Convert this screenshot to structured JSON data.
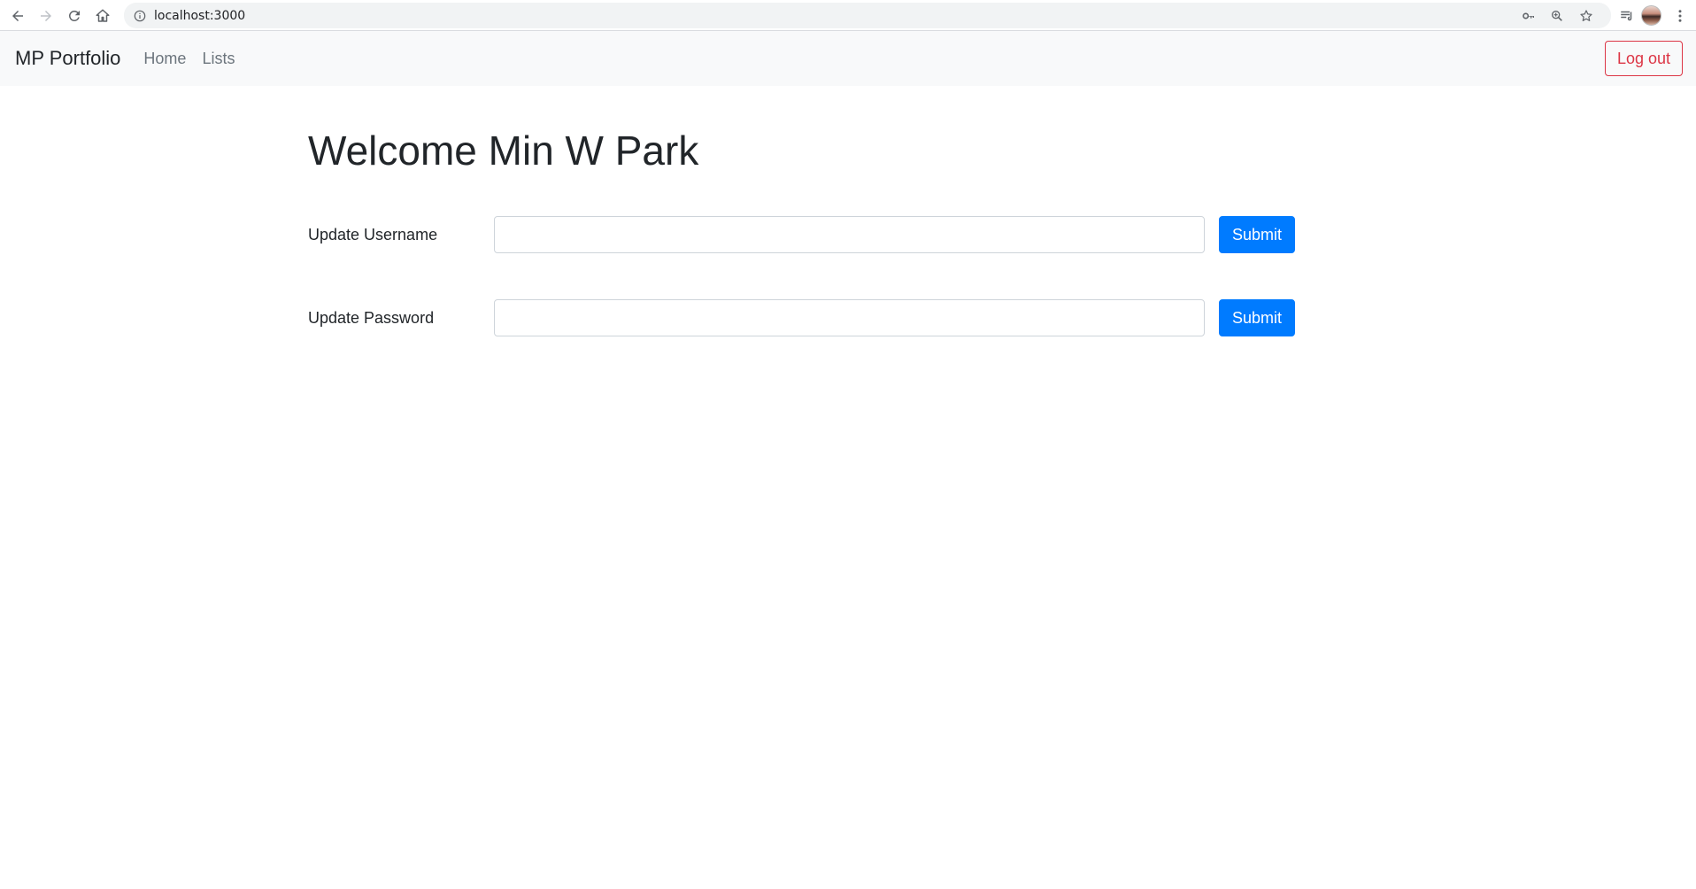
{
  "browser": {
    "url": "localhost:3000",
    "icons": [
      "back-icon",
      "forward-icon",
      "reload-icon",
      "home-icon",
      "info-icon",
      "key-icon",
      "zoom-icon",
      "star-icon",
      "reading-list-icon",
      "avatar",
      "menu-icon"
    ]
  },
  "navbar": {
    "brand": "MP Portfolio",
    "links": [
      "Home",
      "Lists"
    ],
    "logout_label": "Log out"
  },
  "main": {
    "title": "Welcome Min W Park",
    "username_row": {
      "label": "Update Username",
      "value": "",
      "submit_label": "Submit"
    },
    "password_row": {
      "label": "Update Password",
      "value": "",
      "submit_label": "Submit"
    }
  },
  "colors": {
    "primary": "#007bff",
    "danger": "#dc3545",
    "navbar_bg": "#f8f9fa",
    "text": "#212529",
    "muted": "#6c757d"
  }
}
